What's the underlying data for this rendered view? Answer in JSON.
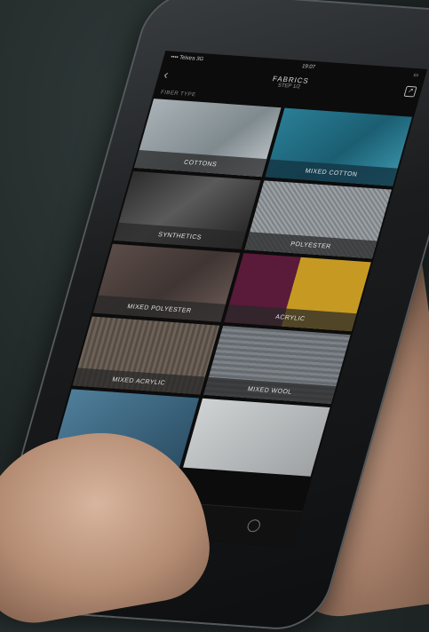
{
  "status": {
    "carrier": "•••• Telstra 3G",
    "time": "19:07"
  },
  "nav": {
    "back_icon": "chevron-left-icon",
    "title": "FABRICS",
    "step": "STEP 1/2",
    "action_icon": "share-icon"
  },
  "section": {
    "label": "FIBER TYPE"
  },
  "fabrics": [
    {
      "label": "COTTONS",
      "selected": false
    },
    {
      "label": "MIXED COTTON",
      "selected": true
    },
    {
      "label": "SYNTHETICS",
      "selected": false
    },
    {
      "label": "POLYESTER",
      "selected": false
    },
    {
      "label": "MIXED POLYESTER",
      "selected": false
    },
    {
      "label": "ACRYLIC",
      "selected": false
    },
    {
      "label": "MIXED ACRYLIC",
      "selected": false
    },
    {
      "label": "MIXED WOOL",
      "selected": false
    },
    {
      "label": "",
      "selected": false
    },
    {
      "label": "",
      "selected": false
    }
  ],
  "tabs": [
    {
      "icon": "shirt-icon",
      "label": ""
    },
    {
      "icon": "clock-icon",
      "label": ""
    },
    {
      "icon": "settings-icon",
      "label": ""
    }
  ]
}
